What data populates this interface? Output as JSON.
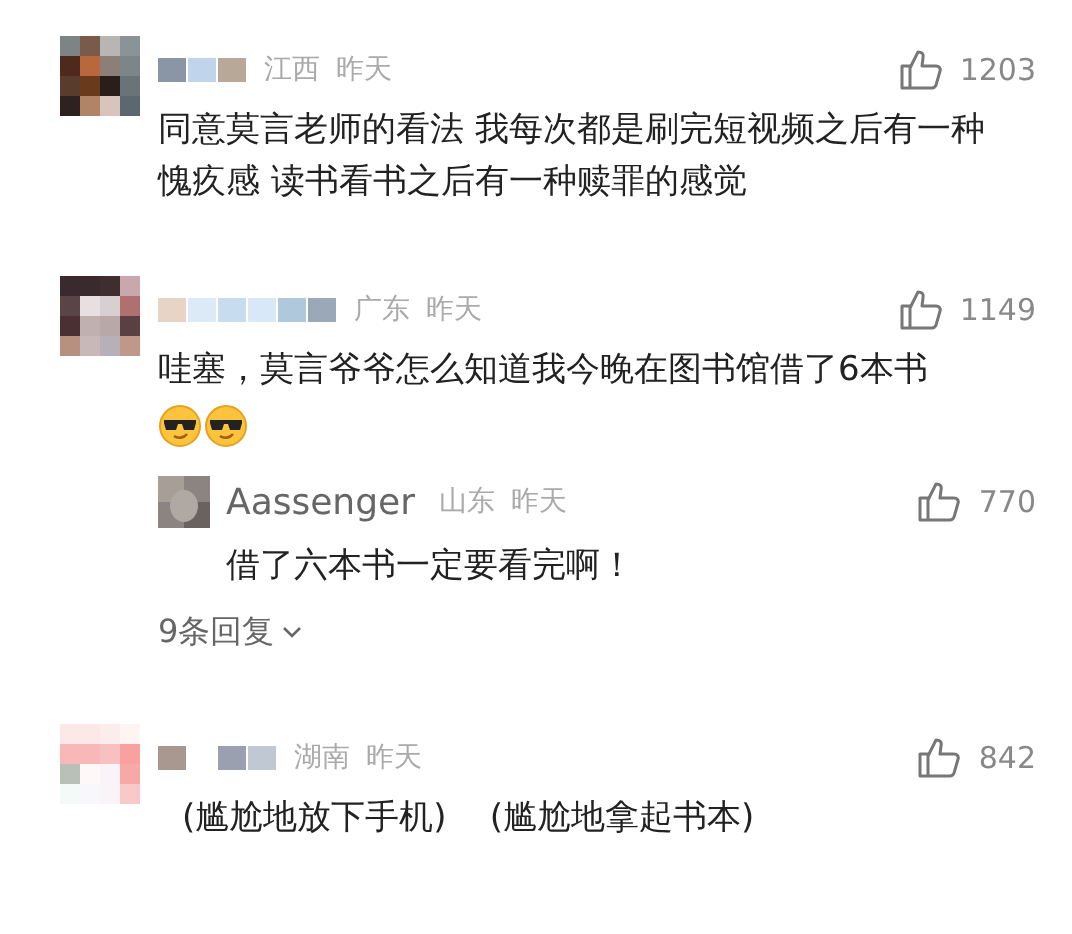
{
  "comments": [
    {
      "region": "江西",
      "time": "昨天",
      "likes": "1203",
      "text": "同意莫言老师的看法 我每次都是刷完短视频之后有一种愧疚感 读书看书之后有一种赎罪的感觉",
      "emoji_line": false
    },
    {
      "region": "广东",
      "time": "昨天",
      "likes": "1149",
      "text": "哇塞，莫言爷爷怎么知道我今晚在图书馆借了6本书",
      "emoji_line": true,
      "reply": {
        "name": "Aassenger",
        "region": "山东",
        "time": "昨天",
        "likes": "770",
        "text": "借了六本书一定要看完啊！"
      },
      "more_replies": "9条回复"
    },
    {
      "region": "湖南",
      "time": "昨天",
      "likes": "842",
      "text": "(尴尬地放下手机)    (尴尬地拿起书本)",
      "emoji_line": false
    }
  ]
}
